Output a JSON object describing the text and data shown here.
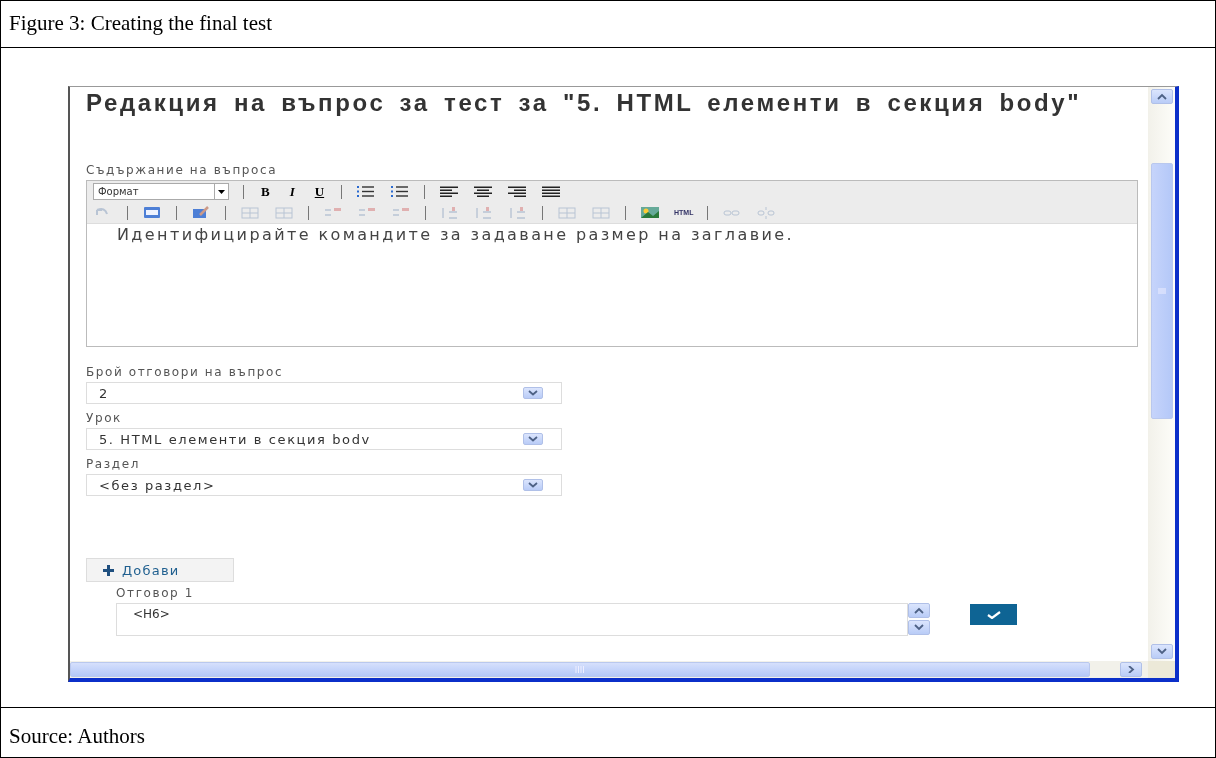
{
  "figure": {
    "caption": "Figure 3: Creating the final test",
    "source": "Source: Authors"
  },
  "page": {
    "title": "Редакция на въпрос за тест за \"5. HTML елементи в секция body\""
  },
  "editor": {
    "label": "Съдържание на въпроса",
    "format": "Формат",
    "toolbar_1": [
      {
        "kind": "bold",
        "text": "B"
      },
      {
        "kind": "italic",
        "text": "I"
      },
      {
        "kind": "underline",
        "text": "U"
      },
      {
        "kind": "sep"
      },
      {
        "kind": "bullets"
      },
      {
        "kind": "numbers"
      },
      {
        "kind": "sep"
      },
      {
        "kind": "align-left"
      },
      {
        "kind": "align-center"
      },
      {
        "kind": "align-right"
      },
      {
        "kind": "justify"
      }
    ],
    "toolbar_2": [
      {
        "kind": "undo",
        "disabled": true
      },
      {
        "kind": "sep"
      },
      {
        "kind": "frame",
        "disabled": false
      },
      {
        "kind": "sep"
      },
      {
        "kind": "edit",
        "disabled": false
      },
      {
        "kind": "sep"
      },
      {
        "kind": "table",
        "disabled": true
      },
      {
        "kind": "table",
        "disabled": true
      },
      {
        "kind": "sep"
      },
      {
        "kind": "row",
        "disabled": true
      },
      {
        "kind": "row",
        "disabled": true
      },
      {
        "kind": "row",
        "disabled": true
      },
      {
        "kind": "sep"
      },
      {
        "kind": "col",
        "disabled": true
      },
      {
        "kind": "col",
        "disabled": true
      },
      {
        "kind": "col",
        "disabled": true
      },
      {
        "kind": "sep"
      },
      {
        "kind": "table",
        "disabled": true
      },
      {
        "kind": "table",
        "disabled": true
      },
      {
        "kind": "sep"
      },
      {
        "kind": "image",
        "disabled": false
      },
      {
        "kind": "html",
        "text": "HTML",
        "disabled": false
      },
      {
        "kind": "sep"
      },
      {
        "kind": "link",
        "disabled": true
      },
      {
        "kind": "unlink",
        "disabled": true
      }
    ],
    "content": "Идентифицирайте командите за задаване размер на заглавие."
  },
  "selects": [
    {
      "label": "Брой отговори на въпрос",
      "value": "2"
    },
    {
      "label": "Урок",
      "value": "5. HTML елементи в секция bodv"
    },
    {
      "label": "Раздел",
      "value": "<без раздел>"
    }
  ],
  "add_button": "Добави",
  "answers": [
    {
      "label": "Отговор 1",
      "value": "<H6>"
    }
  ]
}
